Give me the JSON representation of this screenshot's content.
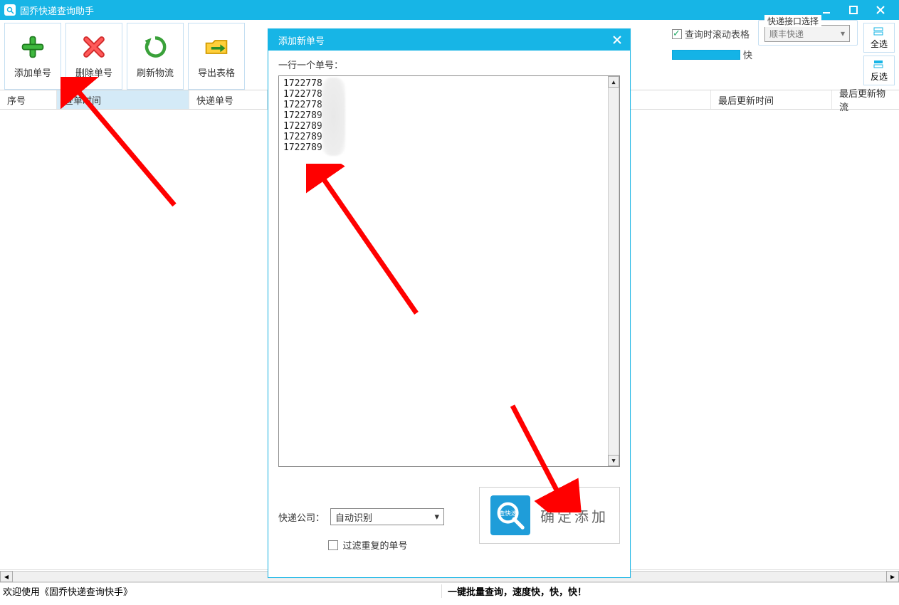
{
  "app": {
    "title": "固乔快递查询助手"
  },
  "toolbar": {
    "add": "添加单号",
    "delete": "删除单号",
    "refresh": "刷新物流",
    "export": "导出表格"
  },
  "options": {
    "scroll_on_query": "查询时滚动表格",
    "speed_suffix": "快",
    "interface_group": "快递接口选择",
    "courier_selected": "顺丰快递",
    "select_all": "全选",
    "invert": "反选"
  },
  "grid": {
    "col_seq": "序号",
    "col_query_time": "查单时间",
    "col_tracking": "快递单号",
    "col_last_update": "最后更新时间",
    "col_last_status": "最后更新物流"
  },
  "dialog": {
    "title": "添加新单号",
    "hint": "一行一个单号：",
    "tracking_lines": [
      "1722778",
      "1722778",
      "1722778",
      "1722789",
      "1722789",
      "1722789",
      "1722789"
    ],
    "courier_label": "快递公司：",
    "courier_selected": "自动识别",
    "filter_dup": "过滤重复的单号",
    "confirm_label": "确定添加",
    "confirm_icon_text": "查快递"
  },
  "status": {
    "left": "欢迎使用《固乔快递查询快手》",
    "right": "一键批量查询，速度快，快，快！"
  }
}
